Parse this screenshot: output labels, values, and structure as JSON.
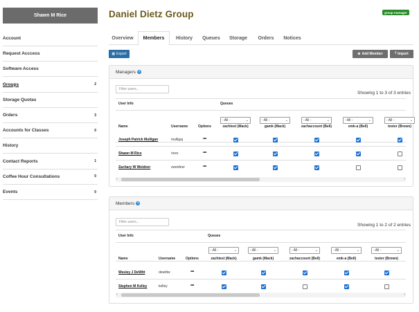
{
  "sidebar": {
    "user_name": "Shawn M Rice",
    "items": [
      {
        "label": "Account",
        "count": ""
      },
      {
        "label": "Request Acccess",
        "count": ""
      },
      {
        "label": "Software Access",
        "count": ""
      },
      {
        "label": "Groups",
        "count": "2"
      },
      {
        "label": "Storage Quotas",
        "count": ""
      },
      {
        "label": "Orders",
        "count": "3"
      },
      {
        "label": "Accounts for Classes",
        "count": "0"
      },
      {
        "label": "History",
        "count": ""
      },
      {
        "label": "Contact Reports",
        "count": "1"
      },
      {
        "label": "Coffee Hour Consultations",
        "count": "0"
      },
      {
        "label": "Events",
        "count": "0"
      }
    ],
    "active_item": "Groups"
  },
  "header": {
    "title": "Daniel Dietz Group",
    "role_badge": "group manager"
  },
  "tabs": [
    {
      "label": "Overview",
      "active": false
    },
    {
      "label": "Members",
      "active": true
    },
    {
      "label": "History",
      "active": false
    },
    {
      "label": "Queues",
      "active": false
    },
    {
      "label": "Storage",
      "active": false
    },
    {
      "label": "Orders",
      "active": false
    },
    {
      "label": "Notices",
      "active": false
    }
  ],
  "toolbar": {
    "export_label": "Export",
    "add_member_label": "Add Member",
    "import_label": "Import"
  },
  "managers": {
    "title": "Managers",
    "filter_placeholder": "Filter users...",
    "showing": "Showing 1 to 3 of 3 entries",
    "group_headers": {
      "user_info": "User Info",
      "queues": "Queues"
    },
    "columns": {
      "name": "Name",
      "username": "Username",
      "options": "Options"
    },
    "filter_value": "- All -",
    "queues": [
      "zachtest (Mack)",
      "gamk (Mack)",
      "zachaccount (Bell)",
      "emk-a (Bell)",
      "tester (Brown)"
    ],
    "rows": [
      {
        "name": "Joseph Patrick Mulligan",
        "username": "mulligaj",
        "options": "•••",
        "queues": [
          true,
          true,
          true,
          true,
          true
        ]
      },
      {
        "name": "Shawn M Rice",
        "username": "rices",
        "options": "•••",
        "queues": [
          true,
          true,
          true,
          true,
          false
        ]
      },
      {
        "name": "Zachary W Weidner",
        "username": "zweidner",
        "options": "•••",
        "queues": [
          true,
          true,
          true,
          false,
          false
        ]
      }
    ]
  },
  "members": {
    "title": "Members",
    "filter_placeholder": "Filter users...",
    "showing": "Showing 1 to 2 of 2 entries",
    "group_headers": {
      "user_info": "User Info",
      "queues": "Queues"
    },
    "columns": {
      "name": "Name",
      "username": "Username",
      "options": "Options"
    },
    "filter_value": "- All -",
    "queues": [
      "zachtest (Mack)",
      "gamk (Mack)",
      "zachaccount (Bell)",
      "emk-a (Bell)",
      "tester (Brown)"
    ],
    "rows": [
      {
        "name": "Wesley J DeWitt",
        "username": "dewittw",
        "options": "•••",
        "queues": [
          true,
          true,
          true,
          true,
          true
        ]
      },
      {
        "name": "Stephen M Kelley",
        "username": "kelley",
        "options": "•••",
        "queues": [
          true,
          true,
          false,
          true,
          false
        ]
      }
    ]
  },
  "colors": {
    "title": "#6b5a1a",
    "badge": "#2a8a2a",
    "export_button": "#2a6ea8",
    "checkbox": "#1a6fd0"
  }
}
